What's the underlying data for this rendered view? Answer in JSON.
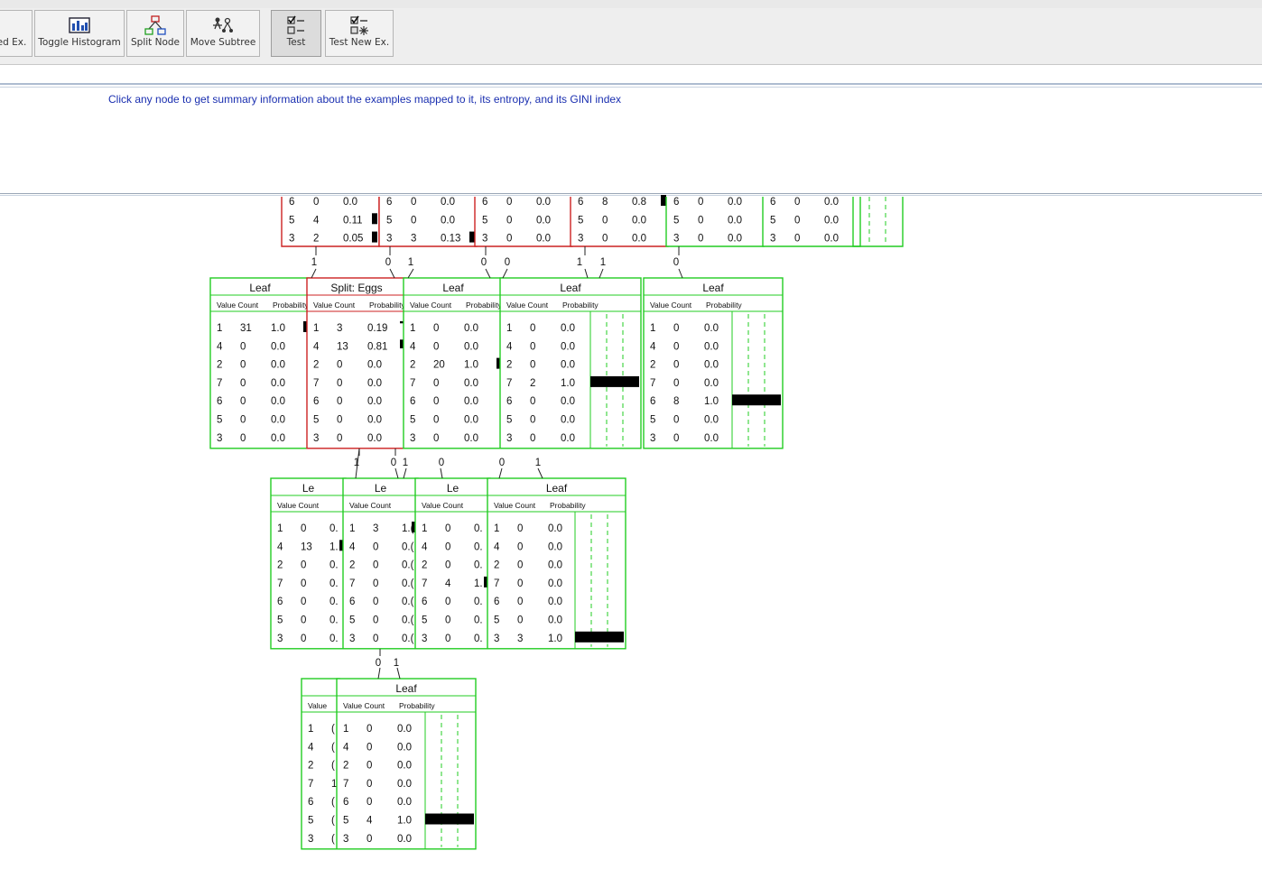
{
  "toolbar": {
    "buttons": [
      {
        "label": "ed Ex.",
        "icon": "add-example-icon"
      },
      {
        "label": "Toggle Histogram",
        "icon": "histogram-icon"
      },
      {
        "label": "Split Node",
        "icon": "split-node-icon"
      },
      {
        "label": "Move Subtree",
        "icon": "move-subtree-icon"
      },
      {
        "label": "Test",
        "icon": "test-icon"
      },
      {
        "label": "Test New Ex.",
        "icon": "test-new-example-icon"
      }
    ]
  },
  "info_text": "Click any node to get summary information about the examples mapped to it, its entropy, and its GINI index",
  "colors": {
    "leaf": "#22cc22",
    "split": "#cc2222",
    "info": "#1a2fb0",
    "bar": "#000000"
  },
  "col_headers": {
    "value": "Value",
    "count": "Count",
    "prob": "Probability"
  },
  "nodes": [
    {
      "id": "t1",
      "rows": [
        [
          "6",
          "0",
          "0.0"
        ],
        [
          "5",
          "4",
          "0.11"
        ],
        [
          "3",
          "2",
          "0.05"
        ]
      ]
    },
    {
      "id": "t2",
      "rows": [
        [
          "6",
          "0",
          "0.0"
        ],
        [
          "5",
          "0",
          "0.0"
        ],
        [
          "3",
          "3",
          "0.13"
        ]
      ]
    },
    {
      "id": "t3",
      "rows": [
        [
          "6",
          "0",
          "0.0"
        ],
        [
          "5",
          "0",
          "0.0"
        ],
        [
          "3",
          "0",
          "0.0"
        ]
      ]
    },
    {
      "id": "t4",
      "rows": [
        [
          "6",
          "8",
          "0.8"
        ],
        [
          "5",
          "0",
          "0.0"
        ],
        [
          "3",
          "0",
          "0.0"
        ]
      ]
    },
    {
      "id": "t5",
      "rows": [
        [
          "6",
          "0",
          "0.0"
        ],
        [
          "5",
          "0",
          "0.0"
        ],
        [
          "3",
          "0",
          "0.0"
        ]
      ]
    },
    {
      "id": "t6",
      "rows": [
        [
          "6",
          "0",
          "0.0"
        ],
        [
          "5",
          "0",
          "0.0"
        ],
        [
          "3",
          "0",
          "0.0"
        ]
      ]
    },
    {
      "id": "m1",
      "title": "Leaf",
      "rows": [
        [
          "1",
          "31",
          "1.0"
        ],
        [
          "4",
          "0",
          "0.0"
        ],
        [
          "2",
          "0",
          "0.0"
        ],
        [
          "7",
          "0",
          "0.0"
        ],
        [
          "6",
          "0",
          "0.0"
        ],
        [
          "5",
          "0",
          "0.0"
        ],
        [
          "3",
          "0",
          "0.0"
        ]
      ]
    },
    {
      "id": "m2",
      "title": "Split: Eggs",
      "rows": [
        [
          "1",
          "3",
          "0.19"
        ],
        [
          "4",
          "13",
          "0.81"
        ],
        [
          "2",
          "0",
          "0.0"
        ],
        [
          "7",
          "0",
          "0.0"
        ],
        [
          "6",
          "0",
          "0.0"
        ],
        [
          "5",
          "0",
          "0.0"
        ],
        [
          "3",
          "0",
          "0.0"
        ]
      ]
    },
    {
      "id": "m3",
      "title": "Leaf",
      "rows": [
        [
          "1",
          "0",
          "0.0"
        ],
        [
          "4",
          "0",
          "0.0"
        ],
        [
          "2",
          "20",
          "1.0"
        ],
        [
          "7",
          "0",
          "0.0"
        ],
        [
          "6",
          "0",
          "0.0"
        ],
        [
          "5",
          "0",
          "0.0"
        ],
        [
          "3",
          "0",
          "0.0"
        ]
      ]
    },
    {
      "id": "m4",
      "title": "Leaf",
      "rows": [
        [
          "1",
          "0",
          "0.0"
        ],
        [
          "4",
          "0",
          "0.0"
        ],
        [
          "2",
          "0",
          "0.0"
        ],
        [
          "7",
          "2",
          "1.0"
        ],
        [
          "6",
          "0",
          "0.0"
        ],
        [
          "5",
          "0",
          "0.0"
        ],
        [
          "3",
          "0",
          "0.0"
        ]
      ]
    },
    {
      "id": "m5",
      "title": "Leaf",
      "rows": [
        [
          "1",
          "0",
          "0.0"
        ],
        [
          "4",
          "0",
          "0.0"
        ],
        [
          "2",
          "0",
          "0.0"
        ],
        [
          "7",
          "0",
          "0.0"
        ],
        [
          "6",
          "8",
          "1.0"
        ],
        [
          "5",
          "0",
          "0.0"
        ],
        [
          "3",
          "0",
          "0.0"
        ]
      ]
    },
    {
      "id": "l1",
      "title": "Le",
      "rows": [
        [
          "1",
          "0",
          "0."
        ],
        [
          "4",
          "13",
          "1."
        ],
        [
          "2",
          "0",
          "0."
        ],
        [
          "7",
          "0",
          "0."
        ],
        [
          "6",
          "0",
          "0."
        ],
        [
          "5",
          "0",
          "0."
        ],
        [
          "3",
          "0",
          "0."
        ]
      ]
    },
    {
      "id": "l2",
      "title": "Le",
      "rows": [
        [
          "1",
          "3",
          "1.("
        ],
        [
          "4",
          "0",
          "0.("
        ],
        [
          "2",
          "0",
          "0.("
        ],
        [
          "7",
          "0",
          "0.("
        ],
        [
          "6",
          "0",
          "0.("
        ],
        [
          "5",
          "0",
          "0.("
        ],
        [
          "3",
          "0",
          "0.("
        ]
      ]
    },
    {
      "id": "l3",
      "title": "Le",
      "rows": [
        [
          "1",
          "0",
          "0."
        ],
        [
          "4",
          "0",
          "0."
        ],
        [
          "2",
          "0",
          "0."
        ],
        [
          "7",
          "4",
          "1."
        ],
        [
          "6",
          "0",
          "0."
        ],
        [
          "5",
          "0",
          "0."
        ],
        [
          "3",
          "0",
          "0."
        ]
      ]
    },
    {
      "id": "l4",
      "title": "Leaf",
      "rows": [
        [
          "1",
          "0",
          "0.0"
        ],
        [
          "4",
          "0",
          "0.0"
        ],
        [
          "2",
          "0",
          "0.0"
        ],
        [
          "7",
          "0",
          "0.0"
        ],
        [
          "6",
          "0",
          "0.0"
        ],
        [
          "5",
          "0",
          "0.0"
        ],
        [
          "3",
          "3",
          "1.0"
        ]
      ]
    },
    {
      "id": "b1",
      "title": "",
      "rows": [
        [
          "1",
          "("
        ],
        [
          "4",
          "("
        ],
        [
          "2",
          "("
        ],
        [
          "7",
          "1"
        ],
        [
          "6",
          "("
        ],
        [
          "5",
          "("
        ],
        [
          "3",
          "("
        ]
      ]
    },
    {
      "id": "b2",
      "title": "Leaf",
      "rows": [
        [
          "1",
          "0",
          "0.0"
        ],
        [
          "4",
          "0",
          "0.0"
        ],
        [
          "2",
          "0",
          "0.0"
        ],
        [
          "7",
          "0",
          "0.0"
        ],
        [
          "6",
          "0",
          "0.0"
        ],
        [
          "5",
          "4",
          "1.0"
        ],
        [
          "3",
          "0",
          "0.0"
        ]
      ]
    }
  ],
  "edge_labels": [
    {
      "text": "1"
    },
    {
      "text": "0"
    },
    {
      "text": "1"
    },
    {
      "text": "0"
    },
    {
      "text": "0"
    },
    {
      "text": "1"
    },
    {
      "text": "1"
    },
    {
      "text": "0"
    },
    {
      "text": "1"
    },
    {
      "text": "0"
    },
    {
      "text": "1"
    },
    {
      "text": "0"
    },
    {
      "text": "0"
    },
    {
      "text": "1"
    },
    {
      "text": "0"
    },
    {
      "text": "1"
    }
  ]
}
